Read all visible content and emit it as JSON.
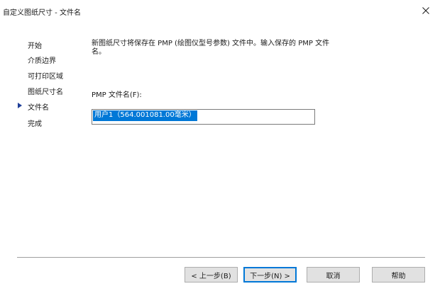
{
  "window": {
    "title": "自定义图纸尺寸 - 文件名",
    "close_glyph": "✕"
  },
  "steps": [
    {
      "label": "开始"
    },
    {
      "label": "介质边界"
    },
    {
      "label": "可打印区域"
    },
    {
      "label": "图纸尺寸名"
    },
    {
      "label": "文件名",
      "current": true
    },
    {
      "label": "完成"
    }
  ],
  "content": {
    "description": "新图纸尺寸将保存在 PMP (绘图仪型号参数) 文件中。输入保存的 PMP 文件名。",
    "filename_label": "PMP 文件名(F):",
    "filename_value": "用户1（564.001081.00毫米）"
  },
  "buttons": {
    "back": "< 上一步(B)",
    "next": "下一步(N) >",
    "cancel": "取消",
    "help": "帮助"
  },
  "colors": {
    "accent": "#0078d7",
    "step_marker": "#1f3f99"
  },
  "icons": {
    "close": "close-icon",
    "current_step": "current-step-arrow-icon"
  }
}
